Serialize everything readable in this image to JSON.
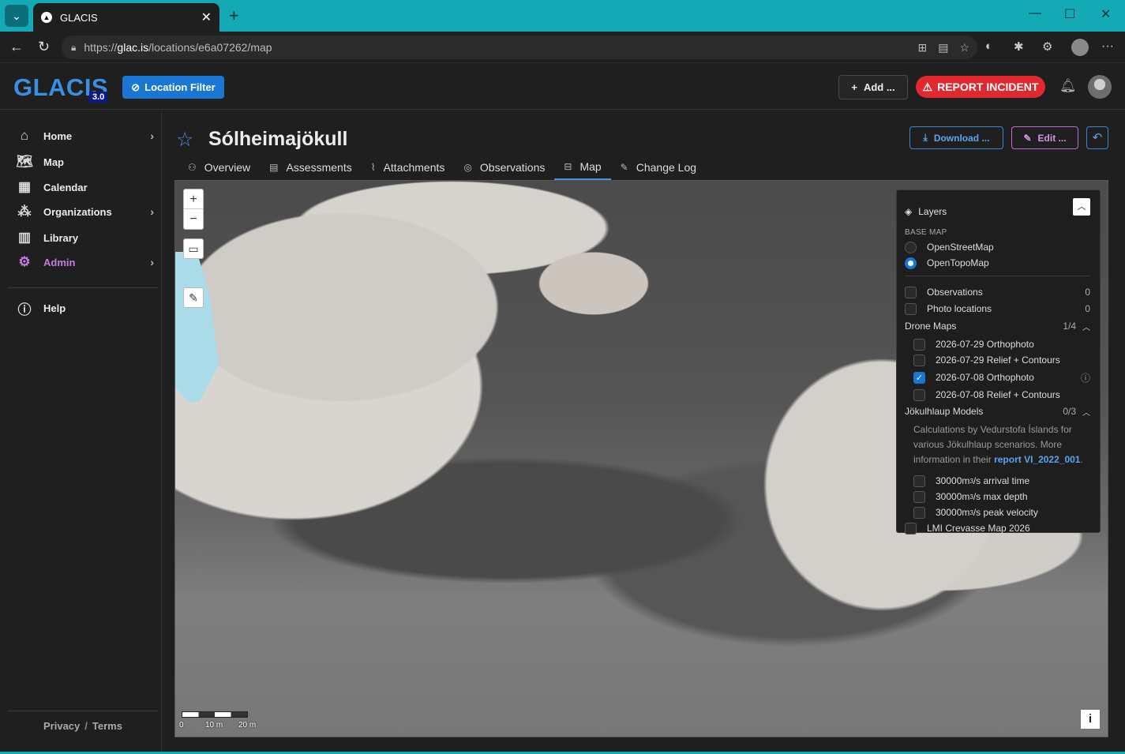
{
  "browser": {
    "tab_title": "GLACIS",
    "url_prefix": "https://",
    "url_domain": "glac.is",
    "url_path": "/locations/e6a07262/map"
  },
  "header": {
    "logo": "GLACIS",
    "version": "3.0",
    "location_filter": "Location Filter",
    "add_label": "Add ...",
    "report_label": "REPORT INCIDENT"
  },
  "sidebar": {
    "items": [
      {
        "label": "Home",
        "icon": "home-icon"
      },
      {
        "label": "Map",
        "icon": "map-icon"
      },
      {
        "label": "Calendar",
        "icon": "calendar-icon"
      },
      {
        "label": "Organizations",
        "icon": "organizations-icon"
      },
      {
        "label": "Library",
        "icon": "library-icon"
      },
      {
        "label": "Admin",
        "icon": "gear-icon"
      },
      {
        "label": "Help",
        "icon": "help-icon"
      }
    ],
    "footer": {
      "privacy": "Privacy",
      "sep": "/",
      "terms": "Terms"
    }
  },
  "page": {
    "title": "Sólheimajökull",
    "download_label": "Download ...",
    "edit_label": "Edit ...",
    "tabs": [
      {
        "label": "Overview"
      },
      {
        "label": "Assessments"
      },
      {
        "label": "Attachments"
      },
      {
        "label": "Observations"
      },
      {
        "label": "Map"
      },
      {
        "label": "Change Log"
      }
    ],
    "active_tab": "Map"
  },
  "map": {
    "zoom_in": "+",
    "zoom_out": "−",
    "scale_labels": [
      "0",
      "10 m",
      "20 m"
    ],
    "info": "i"
  },
  "layers": {
    "title": "Layers",
    "base_map_heading": "BASE MAP",
    "base_maps": [
      {
        "label": "OpenStreetMap",
        "selected": false
      },
      {
        "label": "OpenTopoMap",
        "selected": true
      }
    ],
    "overlays": [
      {
        "label": "Observations",
        "count": "0"
      },
      {
        "label": "Photo locations",
        "count": "0"
      }
    ],
    "drone_group": {
      "label": "Drone Maps",
      "count": "1/4"
    },
    "drone_maps": [
      {
        "label": "2026-07-29 Orthophoto",
        "checked": false
      },
      {
        "label": "2026-07-29 Relief + Contours",
        "checked": false
      },
      {
        "label": "2026-07-08 Orthophoto",
        "checked": true
      },
      {
        "label": "2026-07-08 Relief + Contours",
        "checked": false
      }
    ],
    "jokul_group": {
      "label": "Jökulhlaup Models",
      "count": "0/3"
    },
    "jokul_desc_1": "Calculations by Vedurstofa Íslands for various Jökulhlaup scenarios. More information in their",
    "jokul_link": "report VI_2022_001",
    "jokul_desc_2": ".",
    "jokul_models": [
      {
        "value": "30000m",
        "sup": "3",
        "suffix": "/s arrival time"
      },
      {
        "value": "30000m",
        "sup": "3",
        "suffix": "/s max depth"
      },
      {
        "value": "30000m",
        "sup": "3",
        "suffix": "/s peak velocity"
      }
    ],
    "crevasse": "LMI Crevasse Map 2026"
  }
}
